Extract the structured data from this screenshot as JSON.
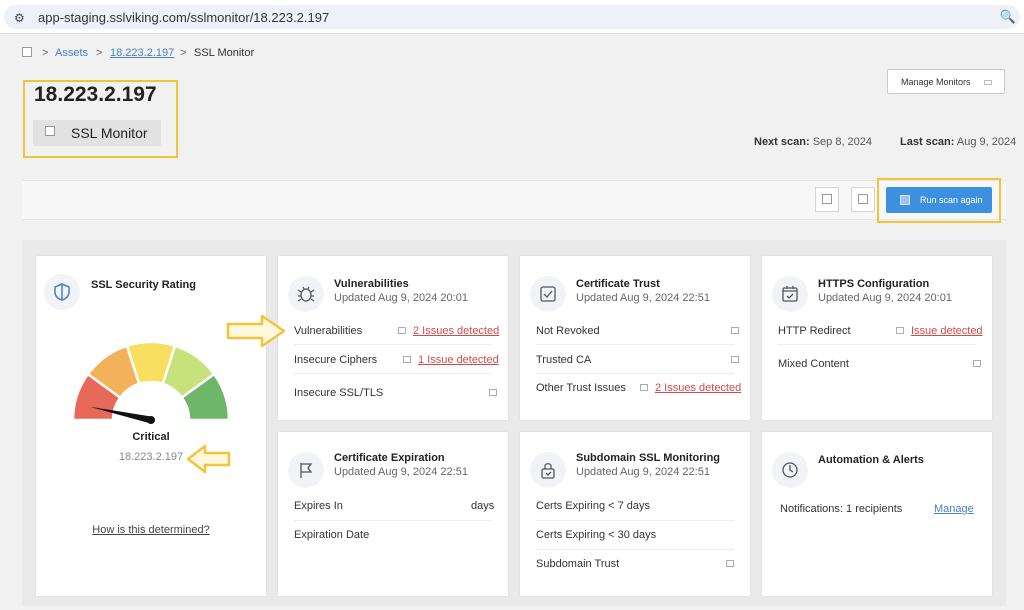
{
  "browser": {
    "url": "app-staging.sslviking.com/sslmonitor/18.223.2.197"
  },
  "breadcrumb": {
    "sep": ">",
    "assets": "Assets",
    "ip": "18.223.2.197",
    "current": "SSL Monitor"
  },
  "header": {
    "title": "18.223.2.197",
    "pill": "SSL Monitor",
    "manage": "Manage Monitors"
  },
  "scan": {
    "next_label": "Next scan:",
    "next_value": "Sep 8, 2024",
    "last_label": "Last scan:",
    "last_value": "Aug 9, 2024"
  },
  "toolbar": {
    "run_label": "Run scan again"
  },
  "rating": {
    "title": "SSL Security Rating",
    "grade": "Critical",
    "host": "18.223.2.197",
    "link": "How is this determined?",
    "level": 0.1
  },
  "vulnerabilities": {
    "title": "Vulnerabilities",
    "updated": "Updated Aug 9, 2024 20:01",
    "rows": [
      {
        "label": "Vulnerabilities",
        "status": "2 Issues detected"
      },
      {
        "label": "Insecure Ciphers",
        "status": "1 Issue detected"
      },
      {
        "label": "Insecure SSL/TLS",
        "status": ""
      }
    ]
  },
  "cert_trust": {
    "title": "Certificate Trust",
    "updated": "Updated Aug 9, 2024 22:51",
    "rows": [
      {
        "label": "Not Revoked",
        "status": ""
      },
      {
        "label": "Trusted CA",
        "status": ""
      },
      {
        "label": "Other Trust Issues",
        "status": "2 Issues detected"
      }
    ]
  },
  "https": {
    "title": "HTTPS Configuration",
    "updated": "Updated Aug 9, 2024 20:01",
    "rows": [
      {
        "label": "HTTP Redirect",
        "status": "Issue detected"
      },
      {
        "label": "Mixed Content",
        "status": ""
      }
    ]
  },
  "expiration": {
    "title": "Certificate Expiration",
    "updated": "Updated Aug 9, 2024 22:51",
    "rows": [
      {
        "label": "Expires In",
        "value": "days"
      },
      {
        "label": "Expiration Date",
        "value": ""
      }
    ]
  },
  "subdomain": {
    "title": "Subdomain SSL Monitoring",
    "updated": "Updated Aug 9, 2024 22:51",
    "rows": [
      {
        "label": "Certs Expiring < 7 days"
      },
      {
        "label": "Certs Expiring < 30 days"
      },
      {
        "label": "Subdomain Trust"
      }
    ]
  },
  "automation": {
    "title": "Automation & Alerts",
    "notifications": "Notifications: 1 recipients",
    "manage": "Manage"
  },
  "colors": {
    "accent": "#3d8fe0",
    "danger": "#d24a4a",
    "highlight": "#f2c43c",
    "gauge": [
      "#e8685a",
      "#f3b25a",
      "#f8df5f",
      "#c6e27a",
      "#6fb56a"
    ]
  }
}
